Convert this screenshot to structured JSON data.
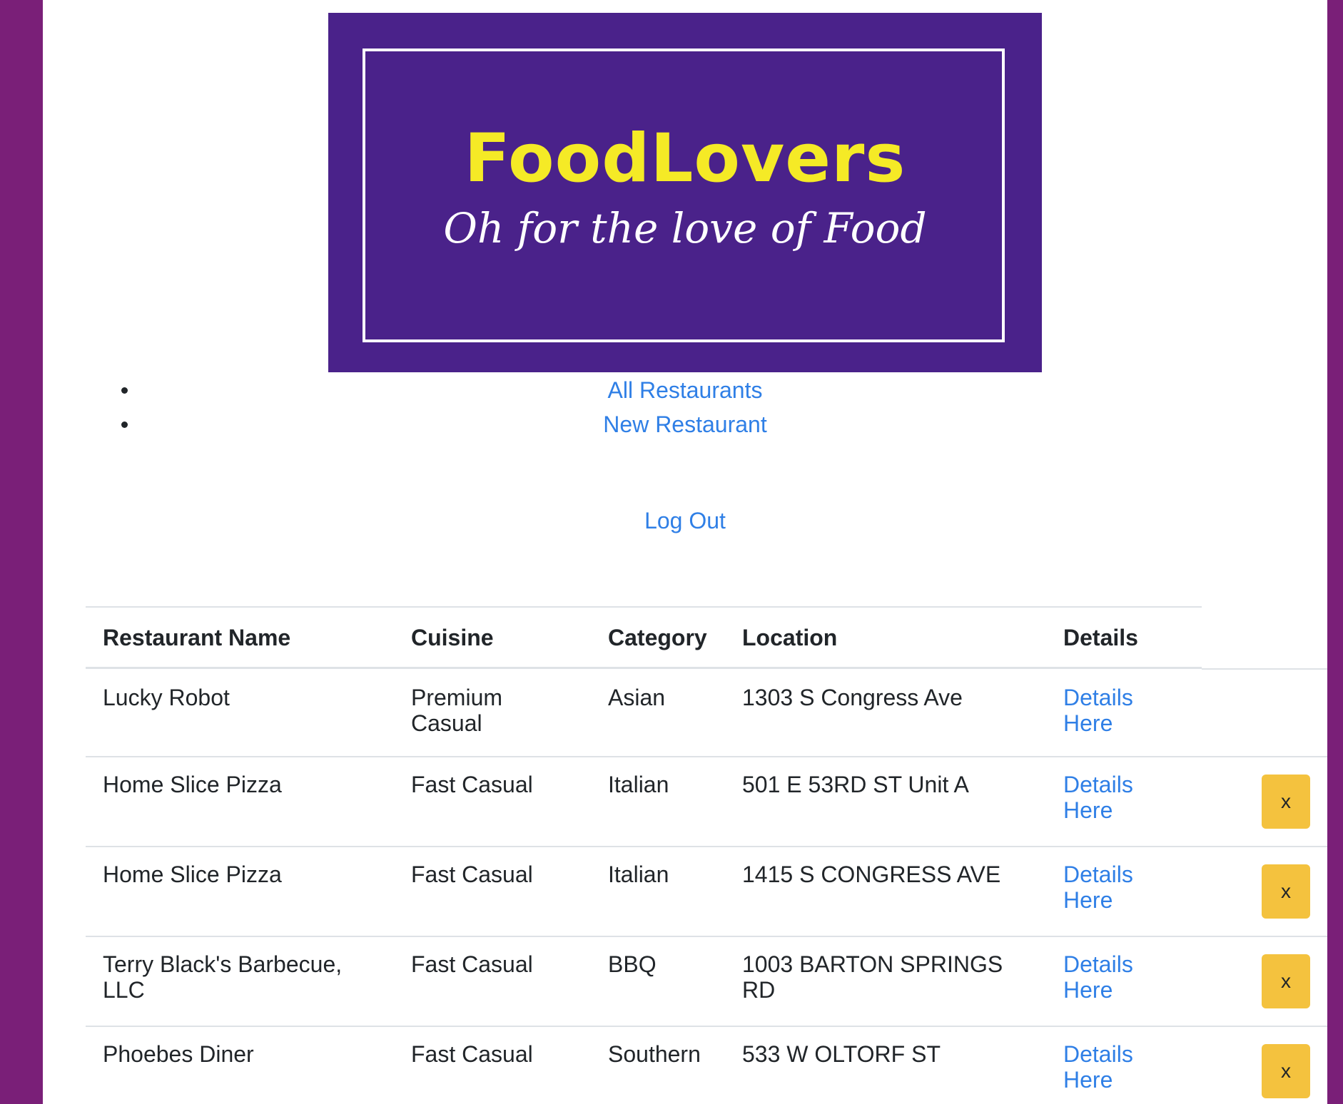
{
  "brand": {
    "name": "FoodLovers",
    "tagline": "Oh for the love of Food"
  },
  "nav": {
    "items": [
      "All Restaurants",
      "New Restaurant"
    ],
    "logout": "Log Out"
  },
  "table": {
    "headers": [
      "Restaurant Name",
      "Cuisine",
      "Category",
      "Location",
      "Details"
    ],
    "rows": [
      {
        "name": "Lucky Robot",
        "cuisine": "Premium Casual",
        "category": "Asian",
        "location": "1303 S Congress Ave",
        "details": "Details Here",
        "delete": null
      },
      {
        "name": "Home Slice Pizza",
        "cuisine": "Fast Casual",
        "category": "Italian",
        "location": "501 E 53RD ST Unit A",
        "details": "Details Here",
        "delete": "x"
      },
      {
        "name": "Home Slice Pizza",
        "cuisine": "Fast Casual",
        "category": "Italian",
        "location": "1415 S CONGRESS AVE",
        "details": "Details Here",
        "delete": "x"
      },
      {
        "name": "Terry Black's Barbecue, LLC",
        "cuisine": "Fast Casual",
        "category": "BBQ",
        "location": "1003 BARTON SPRINGS RD",
        "details": "Details Here",
        "delete": "x"
      },
      {
        "name": "Phoebes Diner",
        "cuisine": "Fast Casual",
        "category": "Southern",
        "location": "533 W OLTORF ST",
        "details": "Details Here",
        "delete": "x"
      }
    ]
  },
  "colors": {
    "page_background": "#7a1f78",
    "logo_background": "#4a228a",
    "logo_title": "#f5ea26",
    "link": "#2f7fe6",
    "delete_button": "#f4c23e"
  }
}
